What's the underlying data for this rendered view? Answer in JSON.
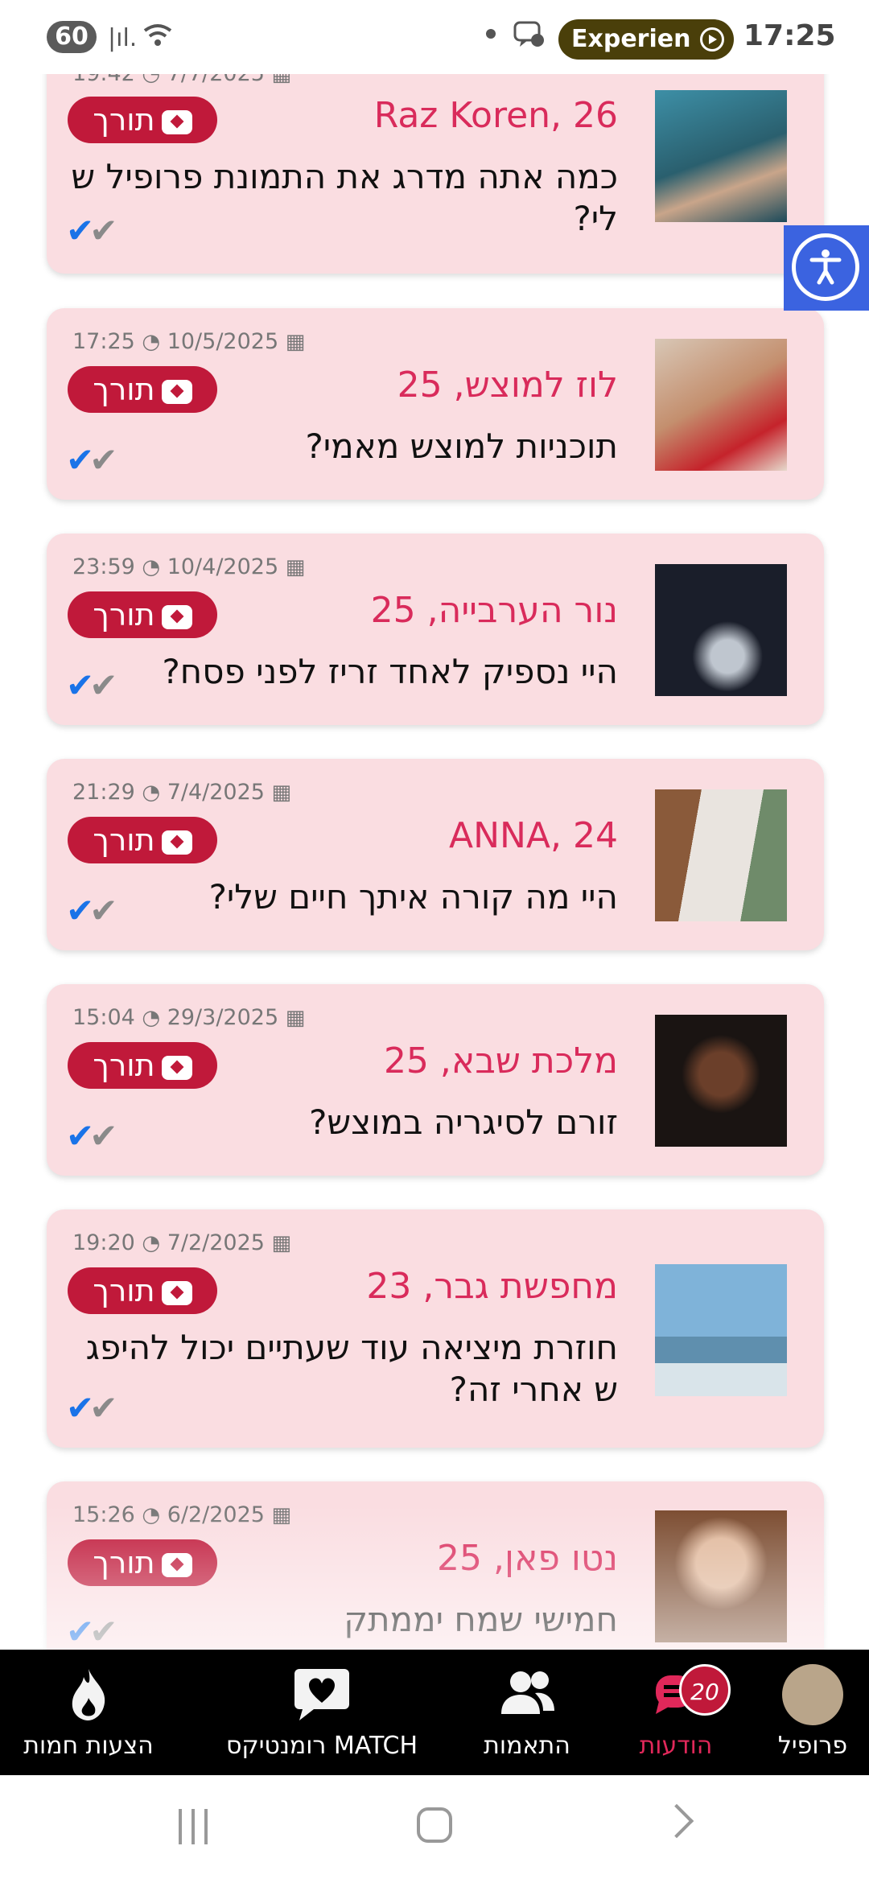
{
  "status_bar": {
    "battery": "60",
    "pill_label": "Experien",
    "time": "17:25"
  },
  "messages": [
    {
      "name": "Raz Koren, 26",
      "text": "כמה אתה מדרג את התמונת פרופיל ש לי?",
      "date": "7/7/2025",
      "time": "19:42",
      "translate_label": "תורך"
    },
    {
      "name": "לוז למוצש, 25",
      "text": "תוכניות למוצש מאמי?",
      "date": "10/5/2025",
      "time": "17:25",
      "translate_label": "תורך"
    },
    {
      "name": "נור הערבייה, 25",
      "text": "היי נספיק לאחד זריז לפני פסח?",
      "date": "10/4/2025",
      "time": "23:59",
      "translate_label": "תורך"
    },
    {
      "name": "ANNA, 24",
      "text": "היי מה קורה איתך חיים שלי?",
      "date": "7/4/2025",
      "time": "21:29",
      "translate_label": "תורך"
    },
    {
      "name": "מלכת שבא, 25",
      "text": "זורם לסיגריה במוצש?",
      "date": "29/3/2025",
      "time": "15:04",
      "translate_label": "תורך"
    },
    {
      "name": "מחפשת גבר, 23",
      "text": "חוזרת מיציאה עוד שעתיים יכול להיפג ש אחרי זה?",
      "date": "7/2/2025",
      "time": "19:20",
      "translate_label": "תורך"
    },
    {
      "name": "נטו פאן, 25",
      "text": "חמישי שמח יממתק",
      "date": "6/2/2025",
      "time": "15:26",
      "translate_label": "תורך"
    }
  ],
  "bottom_nav": {
    "hot_offers": "הצעות חמות",
    "romantic_match": "רומנטיקס MATCH",
    "matches": "התאמות",
    "messages": "הודעות",
    "messages_badge": "20",
    "profile": "פרופיל"
  },
  "colors": {
    "card_bg": "#fadde1",
    "name": "#d92b5b",
    "translate_btn": "#c0193a",
    "nav_active": "#e0285a"
  },
  "icons": [
    "battery-icon",
    "signal-icon",
    "wifi-icon",
    "chat-icon",
    "calendar-icon",
    "clock-icon",
    "chat-bubble-icon",
    "double-check-icon",
    "accessibility-icon",
    "fire-icon",
    "heart-chat-icon",
    "people-icon",
    "messages-icon"
  ]
}
